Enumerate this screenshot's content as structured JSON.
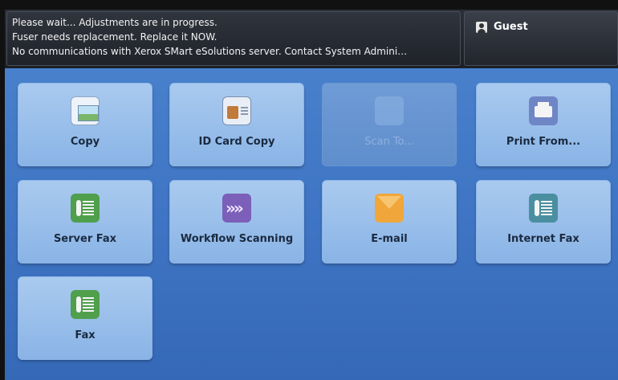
{
  "status": {
    "messages": [
      "Please wait... Adjustments are in progress.",
      "Fuser needs replacement.  Replace it NOW.",
      "No communications with Xerox SMart eSolutions server. Contact System Admini…"
    ],
    "user": {
      "icon": "user-icon",
      "label": "Guest"
    }
  },
  "apps": [
    {
      "label": "Copy",
      "icon": "copy-icon",
      "enabled": true
    },
    {
      "label": "ID Card Copy",
      "icon": "id-card-copy-icon",
      "enabled": true
    },
    {
      "label": "Scan To...",
      "icon": "scan-to-icon",
      "enabled": false
    },
    {
      "label": "Print From...",
      "icon": "printer-icon",
      "enabled": true
    },
    {
      "label": "Server Fax",
      "icon": "fax-icon",
      "enabled": true
    },
    {
      "label": "Workflow Scanning",
      "icon": "workflow-scanning-icon",
      "enabled": true
    },
    {
      "label": "E-mail",
      "icon": "envelope-icon",
      "enabled": true
    },
    {
      "label": "Internet Fax",
      "icon": "internet-fax-icon",
      "enabled": true
    },
    {
      "label": "Fax",
      "icon": "fax-icon",
      "enabled": true
    }
  ],
  "colors": {
    "background": "#3f75c4",
    "status_bar": "#1f2229",
    "tile": "#9cc0eb"
  }
}
